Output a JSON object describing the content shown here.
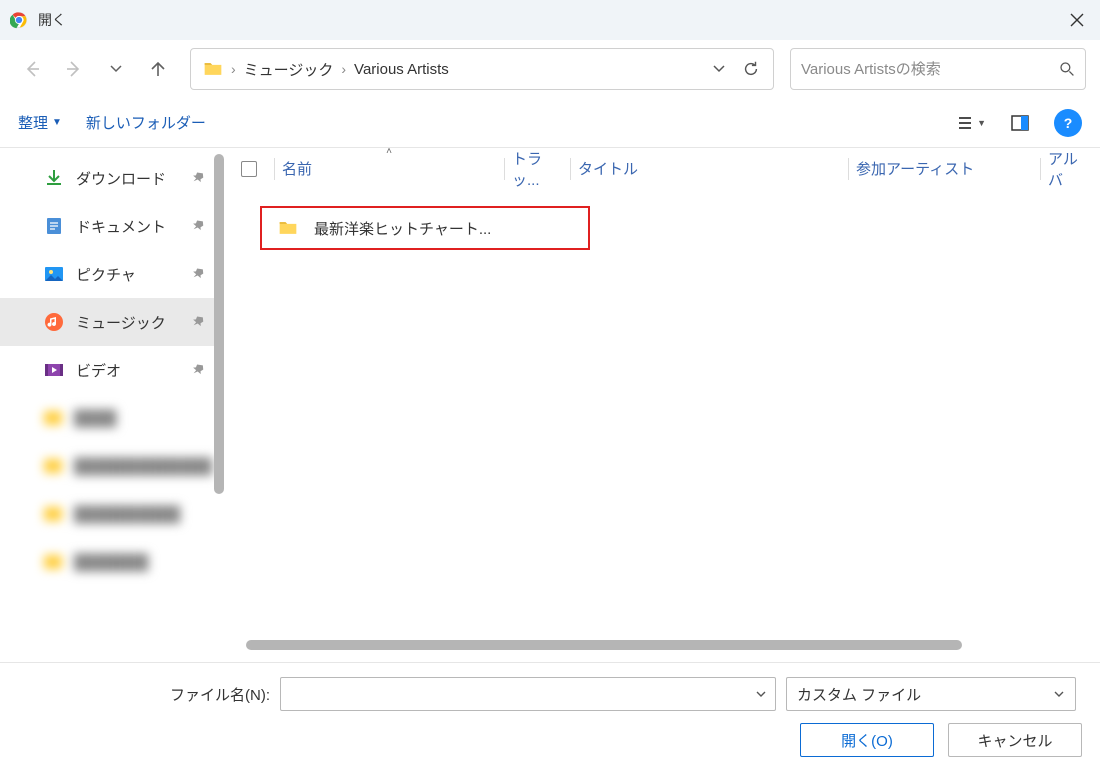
{
  "titlebar": {
    "title": "開く"
  },
  "breadcrumb": {
    "a": "ミュージック",
    "b": "Various Artists"
  },
  "search": {
    "placeholder": "Various Artistsの検索"
  },
  "toolbar": {
    "organize": "整理",
    "newfolder": "新しいフォルダー"
  },
  "sidebar": {
    "downloads": "ダウンロード",
    "documents": "ドキュメント",
    "pictures": "ピクチャ",
    "music": "ミュージック",
    "videos": "ビデオ"
  },
  "columns": {
    "name": "名前",
    "track": "トラッ...",
    "title": "タイトル",
    "artist": "参加アーティスト",
    "album": "アルバ"
  },
  "filelist": {
    "item0": {
      "name": "最新洋楽ヒットチャート..."
    }
  },
  "footer": {
    "fnlabel": "ファイル名(N):",
    "filetype": "カスタム ファイル",
    "open": "開く(O)",
    "cancel": "キャンセル"
  }
}
